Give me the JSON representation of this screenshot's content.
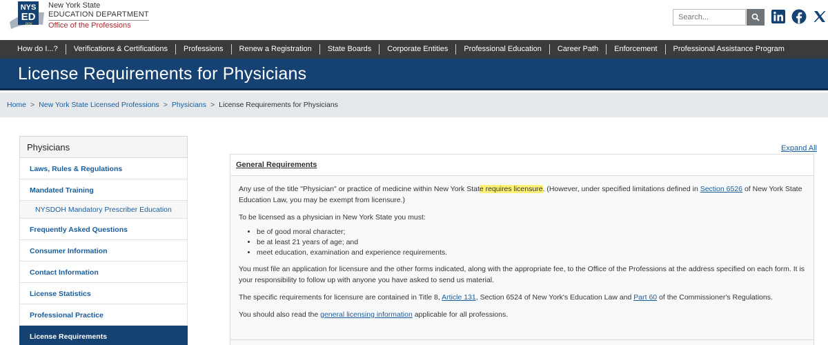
{
  "header": {
    "logo_line1": "New York State",
    "logo_line2": "EDUCATION DEPARTMENT",
    "logo_line3": "Office of the Professions",
    "logo_badge_top": "NYS",
    "logo_badge_mid": "ED",
    "logo_badge_bottom": ".gov",
    "search_placeholder": "Search...",
    "social": [
      "linkedin-icon",
      "facebook-icon",
      "x-icon"
    ]
  },
  "nav": {
    "items": [
      "How do I...?",
      "Verifications & Certifications",
      "Professions",
      "Renew a Registration",
      "State Boards",
      "Corporate Entities",
      "Professional Education",
      "Career Path",
      "Enforcement",
      "Professional Assistance Program"
    ]
  },
  "page": {
    "title": "License Requirements for Physicians"
  },
  "breadcrumb": {
    "items": [
      "Home",
      "New York State Licensed Professions",
      "Physicians",
      "License Requirements for Physicians"
    ],
    "separator": ">"
  },
  "sidebar": {
    "heading": "Physicians",
    "items": [
      "Laws, Rules & Regulations",
      "Mandated Training",
      "NYSDOH Mandatory Prescriber Education",
      "Frequently Asked Questions",
      "Consumer Information",
      "Contact Information",
      "License Statistics",
      "Professional Practice",
      "License Requirements"
    ]
  },
  "main": {
    "expand_all": "Expand All",
    "section_title": "General Requirements",
    "p1_a": "Any use of the title \"Physician\" or practice of medicine within New York Stat",
    "p1_hl": "e requires licensure",
    "p1_b": ". (However, under specified limitations defined in ",
    "p1_link": "Section 6526",
    "p1_c": " of New York State Education Law, you may be exempt from licensure.)",
    "p2": "To be licensed as a physician in New York State you must:",
    "bullets": [
      "be of good moral character;",
      "be at least 21 years of age; and",
      "meet education, examination and experience requirements."
    ],
    "p3": "You must file an application for licensure and the other forms indicated, along with the appropriate fee, to the Office of the Professions at the address specified on each form. It is your responsibility to follow up with anyone you have asked to send us material.",
    "p4_a": "The specific requirements for licensure are contained in Title 8, ",
    "p4_link1": "Article 131",
    "p4_b": ", Section 6524 of New York's Education Law and ",
    "p4_link2": "Part 60",
    "p4_c": " of the Commissioner's Regulations.",
    "p5_a": "You should also read the ",
    "p5_link": "general licensing information",
    "p5_b": " applicable for all professions."
  },
  "colors": {
    "brand_blue": "#154273",
    "nav_bg": "#3a3b3c",
    "link": "#1a5c9a",
    "highlight": "#fff176"
  }
}
